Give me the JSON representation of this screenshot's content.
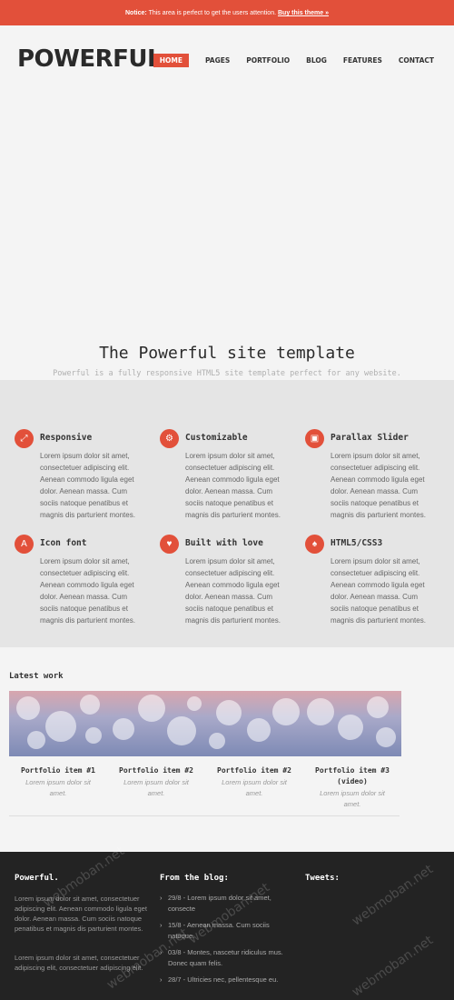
{
  "notice": {
    "label": "Notice:",
    "text": "This area is perfect to get the users attention.",
    "cta": "Buy this theme »"
  },
  "logo": "POWERFUL.",
  "nav": [
    "HOME",
    "PAGES",
    "PORTFOLIO",
    "BLOG",
    "FEATURES",
    "CONTACT"
  ],
  "hero": {
    "title": "The Powerful site template",
    "subtitle": "Powerful is a fully responsive HTML5 site template perfect for any website."
  },
  "features": [
    {
      "icon": "expand-icon",
      "glyph": "⤢",
      "title": "Responsive",
      "text": "Lorem ipsum dolor sit amet, consectetuer adipiscing elit. Aenean commodo ligula eget dolor. Aenean massa. Cum sociis natoque penatibus et magnis dis parturient montes."
    },
    {
      "icon": "gears-icon",
      "glyph": "⚙",
      "title": "Customizable",
      "text": "Lorem ipsum dolor sit amet, consectetuer adipiscing elit. Aenean commodo ligula eget dolor. Aenean massa. Cum sociis natoque penatibus et magnis dis parturient montes."
    },
    {
      "icon": "picture-icon",
      "glyph": "▣",
      "title": "Parallax Slider",
      "text": "Lorem ipsum dolor sit amet, consectetuer adipiscing elit. Aenean commodo ligula eget dolor. Aenean massa. Cum sociis natoque penatibus et magnis dis parturient montes."
    },
    {
      "icon": "font-icon",
      "glyph": "A",
      "title": "Icon font",
      "text": "Lorem ipsum dolor sit amet, consectetuer adipiscing elit. Aenean commodo ligula eget dolor. Aenean massa. Cum sociis natoque penatibus et magnis dis parturient montes."
    },
    {
      "icon": "heart-icon",
      "glyph": "♥",
      "title": "Built with love",
      "text": "Lorem ipsum dolor sit amet, consectetuer adipiscing elit. Aenean commodo ligula eget dolor. Aenean massa. Cum sociis natoque penatibus et magnis dis parturient montes."
    },
    {
      "icon": "html5-icon",
      "glyph": "♠",
      "title": "HTML5/CSS3",
      "text": "Lorem ipsum dolor sit amet, consectetuer adipiscing elit. Aenean commodo ligula eget dolor. Aenean massa. Cum sociis natoque penatibus et magnis dis parturient montes."
    }
  ],
  "latest_work": {
    "title": "Latest work",
    "items": [
      {
        "title": "Portfolio item #1",
        "desc": "Lorem ipsum dolor sit amet."
      },
      {
        "title": "Portfolio item #2",
        "desc": "Lorem ipsum dolor sit amet."
      },
      {
        "title": "Portfolio item #2",
        "desc": "Lorem ipsum dolor sit amet."
      },
      {
        "title": "Portfolio item #3 (video)",
        "desc": "Lorem ipsum dolor sit amet."
      }
    ]
  },
  "footer": {
    "about_title": "Powerful.",
    "about_p1": "Lorem ipsum dolor sit amet, consectetuer adipiscing elit. Aenean commodo ligula eget dolor. Aenean massa. Cum sociis natoque penatibus et magnis dis parturient montes.",
    "about_p2": "Lorem ipsum dolor sit amet, consectetuer adipiscing elit, consectetuer adipiscing elit.",
    "blog_title": "From the blog:",
    "blog_items": [
      "29/8 - Lorem ipsum dolor sit amet, consecte",
      "15/8 - Aenean massa. Cum sociis natoque.",
      "03/8 - Montes, nascetur ridiculus mus. Donec quam felis.",
      "28/7 - Ultricies nec, pellentesque eu."
    ],
    "tweets_title": "Tweets:"
  },
  "watermark": "webmoban.net",
  "colors": {
    "accent": "#e2503a",
    "footer_bg": "#232323",
    "features_bg": "#e5e5e5"
  }
}
